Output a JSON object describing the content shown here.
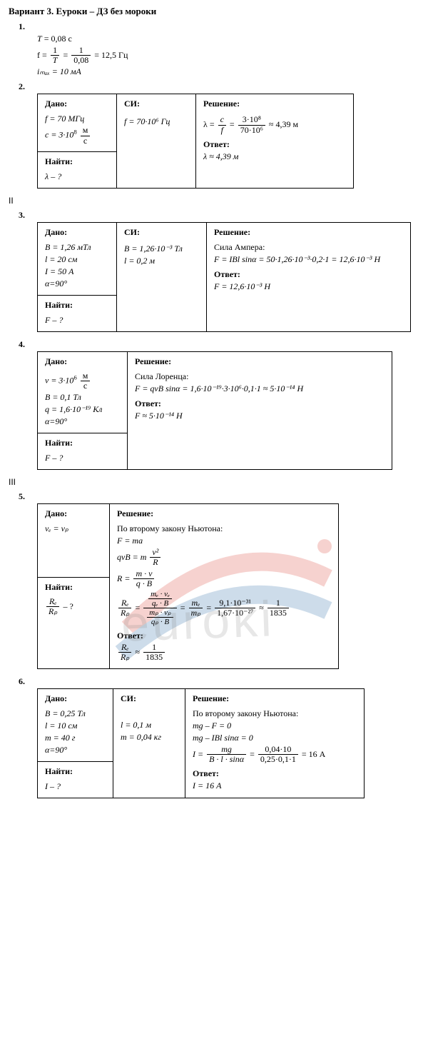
{
  "title": "Вариант 3. Еуроки – ДЗ без мороки",
  "p1": {
    "num": "1.",
    "l1_lhs": "T",
    "l1_eq": "= 0,08 с",
    "l2_lhs": "f =",
    "l2_f1n": "1",
    "l2_f1d": "T",
    "l2_mid": "=",
    "l2_f2n": "1",
    "l2_f2d": "0,08",
    "l2_rhs": "= 12,5 Гц",
    "l3": "iₘₐₓ = 10 мА"
  },
  "p2": {
    "num": "2.",
    "given_h": "Дано:",
    "si_h": "СИ:",
    "sol_h": "Решение:",
    "g1": "f = 70 МГц",
    "g2_a": "c = 3·10",
    "g2_exp": "8",
    "g2_un": "м",
    "g2_ud": "с",
    "si1": "f = 70·10⁶ Гц",
    "sol_lhs": "λ =",
    "sol_f1n": "c",
    "sol_f1d": "f",
    "sol_mid": "=",
    "sol_f2n": "3·10⁸",
    "sol_f2d": "70·10⁶",
    "sol_rhs": "≈ 4,39 м",
    "ans_h": "Ответ:",
    "ans": "λ ≈ 4,39 м",
    "find_h": "Найти:",
    "find": "λ – ?"
  },
  "secII": "II",
  "p3": {
    "num": "3.",
    "given_h": "Дано:",
    "si_h": "СИ:",
    "sol_h": "Решение:",
    "g1": "B = 1,26 мТл",
    "g2": "l = 20 см",
    "g3": "I = 50 А",
    "g4": "α=90°",
    "si1": "B = 1,26·10⁻³ Тл",
    "si2": "l = 0,2 м",
    "s1": "Сила Ампера:",
    "s2": "F = IBl sinα = 50·1,26·10⁻³·0,2·1 = 12,6·10⁻³ Н",
    "ans_h": "Ответ:",
    "ans": "F = 12,6·10⁻³ Н",
    "find_h": "Найти:",
    "find": "F – ?"
  },
  "p4": {
    "num": "4.",
    "given_h": "Дано:",
    "sol_h": "Решение:",
    "g1_a": "v = 3·10",
    "g1_exp": "6",
    "g1_un": "м",
    "g1_ud": "с",
    "g2": "B = 0,1 Тл",
    "g3": "q = 1,6·10⁻¹⁹ Кл",
    "g4": "α=90°",
    "s1": "Сила Лоренца:",
    "s2": "F = qvB sinα = 1,6·10⁻¹⁹·3·10⁶·0,1·1 ≈ 5·10⁻¹⁴ Н",
    "ans_h": "Ответ:",
    "ans": "F ≈ 5·10⁻¹⁴ Н",
    "find_h": "Найти:",
    "find": "F – ?"
  },
  "secIII": "III",
  "p5": {
    "num": "5.",
    "given_h": "Дано:",
    "sol_h": "Решение:",
    "g1": "vₑ = vₚ",
    "find_h": "Найти:",
    "find_n": "Rₑ",
    "find_d": "Rₚ",
    "find_suf": " – ?",
    "s1": "По второму закону Ньютона:",
    "s2": "F = ma",
    "s3_lhs": "qvB = m",
    "s3_fn": "v²",
    "s3_fd": "R",
    "s4_lhs": "R =",
    "s4_fn": "m · v",
    "s4_fd": "q · B",
    "s5_lfn": "Rₑ",
    "s5_lfd": "Rₚ",
    "s5_eq1": "=",
    "s5_m1nn": "mₑ · vₑ",
    "s5_m1nd": "qₑ · B",
    "s5_m1dn": "mₚ · vₚ",
    "s5_m1dd": "qₚ · B",
    "s5_eq2": "=",
    "s5_m2n": "mₑ",
    "s5_m2d": "mₚ",
    "s5_eq3": "=",
    "s5_m3n": "9,1·10⁻³¹",
    "s5_m3d": "1,67·10⁻²⁷",
    "s5_eq4": "≈",
    "s5_m4n": "1",
    "s5_m4d": "1835",
    "ans_h": "Ответ:",
    "ans_fn": "Rₑ",
    "ans_fd": "Rₚ",
    "ans_mid": "≈",
    "ans_rn": "1",
    "ans_rd": "1835"
  },
  "p6": {
    "num": "6.",
    "given_h": "Дано:",
    "si_h": "СИ:",
    "sol_h": "Решение:",
    "g1": "B = 0,25 Тл",
    "g2": "l = 10 см",
    "g3": "m = 40 г",
    "g4": "α=90°",
    "si1": "l = 0,1 м",
    "si2": "m = 0,04 кг",
    "s1": "По второму закону Ньютона:",
    "s2": "mg – F = 0",
    "s3": "mg – IBl sinα = 0",
    "s4_lhs": "I =",
    "s4_f1n": "mg",
    "s4_f1d": "B · l · sinα",
    "s4_mid": "=",
    "s4_f2n": "0,04·10",
    "s4_f2d": "0,25·0,1·1",
    "s4_rhs": "= 16 А",
    "ans_h": "Ответ:",
    "ans": "I = 16 А",
    "find_h": "Найти:",
    "find": "I – ?"
  },
  "watermark": "euroki"
}
